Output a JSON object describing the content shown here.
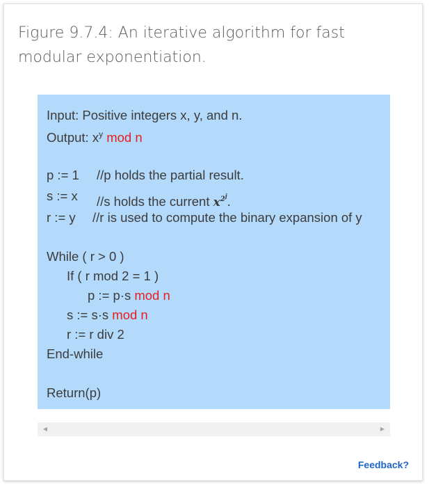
{
  "figure": {
    "title": "Figure 9.7.4: An iterative algorithm for fast modular exponentiation."
  },
  "algorithm": {
    "input": "Input: Positive integers x, y, and n.",
    "output_prefix": "Output: x",
    "output_sup": "y",
    "mod_n": "mod n",
    "p_init": {
      "code": "p := 1",
      "comment": "//p holds the partial result."
    },
    "s_init": {
      "code": "s := x",
      "comment_prefix": "//s holds the current",
      "math_base": "x",
      "math_exp_base": "2",
      "math_exp_sup": "j",
      "comment_suffix": "."
    },
    "r_init": {
      "code": "r := y",
      "comment": "//r is used to compute the binary expansion of y"
    },
    "while": "While ( r > 0 )",
    "if": "If ( r mod 2 = 1 )",
    "p_update": "p := p·s",
    "s_update": "s := s·s",
    "r_update": "r := r div 2",
    "end_while": "End-while",
    "return": "Return(p)"
  },
  "scrollbar": {
    "left_icon": "scroll-left-arrow-icon",
    "right_icon": "scroll-right-arrow-icon"
  },
  "feedback_label": "Feedback?"
}
